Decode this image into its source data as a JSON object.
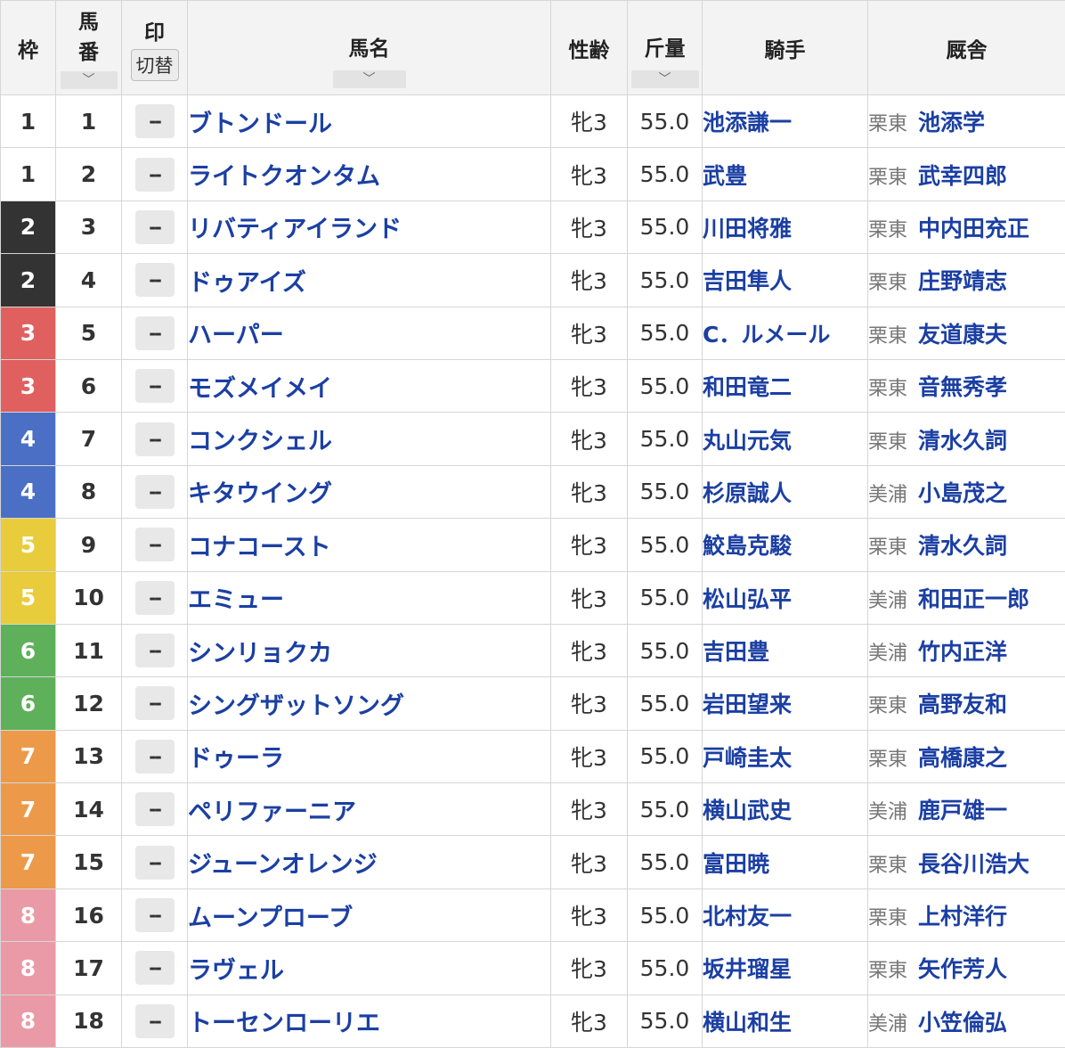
{
  "header": {
    "waku": "枠",
    "umaban_line1": "馬",
    "umaban_line2": "番",
    "mark": "印",
    "mark_toggle": "切替",
    "horse": "馬名",
    "sexage": "性齢",
    "weight": "斤量",
    "jockey": "騎手",
    "stable": "厩舎",
    "sort_glyph": "﹀"
  },
  "mark_placeholder": "--",
  "waku_colors": {
    "1": {
      "bg": "#ffffff",
      "fg": "#333333"
    },
    "2": {
      "bg": "#333333",
      "fg": "#ffffff"
    },
    "3": {
      "bg": "#e06060",
      "fg": "#ffffff"
    },
    "4": {
      "bg": "#4a6fc4",
      "fg": "#ffffff"
    },
    "5": {
      "bg": "#e8cc3c",
      "fg": "#ffffff"
    },
    "6": {
      "bg": "#5fb05a",
      "fg": "#ffffff"
    },
    "7": {
      "bg": "#ec9a4a",
      "fg": "#ffffff"
    },
    "8": {
      "bg": "#ea9aa6",
      "fg": "#ffffff"
    }
  },
  "rows": [
    {
      "waku": "1",
      "umaban": "1",
      "horse": "ブトンドール",
      "sexage": "牝3",
      "weight": "55.0",
      "jockey": "池添謙一",
      "region": "栗東",
      "trainer": "池添学"
    },
    {
      "waku": "1",
      "umaban": "2",
      "horse": "ライトクオンタム",
      "sexage": "牝3",
      "weight": "55.0",
      "jockey": "武豊",
      "region": "栗東",
      "trainer": "武幸四郎"
    },
    {
      "waku": "2",
      "umaban": "3",
      "horse": "リバティアイランド",
      "sexage": "牝3",
      "weight": "55.0",
      "jockey": "川田将雅",
      "region": "栗東",
      "trainer": "中内田充正"
    },
    {
      "waku": "2",
      "umaban": "4",
      "horse": "ドゥアイズ",
      "sexage": "牝3",
      "weight": "55.0",
      "jockey": "吉田隼人",
      "region": "栗東",
      "trainer": "庄野靖志"
    },
    {
      "waku": "3",
      "umaban": "5",
      "horse": "ハーパー",
      "sexage": "牝3",
      "weight": "55.0",
      "jockey": "C．ルメール",
      "region": "栗東",
      "trainer": "友道康夫"
    },
    {
      "waku": "3",
      "umaban": "6",
      "horse": "モズメイメイ",
      "sexage": "牝3",
      "weight": "55.0",
      "jockey": "和田竜二",
      "region": "栗東",
      "trainer": "音無秀孝"
    },
    {
      "waku": "4",
      "umaban": "7",
      "horse": "コンクシェル",
      "sexage": "牝3",
      "weight": "55.0",
      "jockey": "丸山元気",
      "region": "栗東",
      "trainer": "清水久詞"
    },
    {
      "waku": "4",
      "umaban": "8",
      "horse": "キタウイング",
      "sexage": "牝3",
      "weight": "55.0",
      "jockey": "杉原誠人",
      "region": "美浦",
      "trainer": "小島茂之"
    },
    {
      "waku": "5",
      "umaban": "9",
      "horse": "コナコースト",
      "sexage": "牝3",
      "weight": "55.0",
      "jockey": "鮫島克駿",
      "region": "栗東",
      "trainer": "清水久詞"
    },
    {
      "waku": "5",
      "umaban": "10",
      "horse": "エミュー",
      "sexage": "牝3",
      "weight": "55.0",
      "jockey": "松山弘平",
      "region": "美浦",
      "trainer": "和田正一郎"
    },
    {
      "waku": "6",
      "umaban": "11",
      "horse": "シンリョクカ",
      "sexage": "牝3",
      "weight": "55.0",
      "jockey": "吉田豊",
      "region": "美浦",
      "trainer": "竹内正洋"
    },
    {
      "waku": "6",
      "umaban": "12",
      "horse": "シングザットソング",
      "sexage": "牝3",
      "weight": "55.0",
      "jockey": "岩田望来",
      "region": "栗東",
      "trainer": "高野友和"
    },
    {
      "waku": "7",
      "umaban": "13",
      "horse": "ドゥーラ",
      "sexage": "牝3",
      "weight": "55.0",
      "jockey": "戸崎圭太",
      "region": "栗東",
      "trainer": "高橋康之"
    },
    {
      "waku": "7",
      "umaban": "14",
      "horse": "ペリファーニア",
      "sexage": "牝3",
      "weight": "55.0",
      "jockey": "横山武史",
      "region": "美浦",
      "trainer": "鹿戸雄一"
    },
    {
      "waku": "7",
      "umaban": "15",
      "horse": "ジューンオレンジ",
      "sexage": "牝3",
      "weight": "55.0",
      "jockey": "富田暁",
      "region": "栗東",
      "trainer": "長谷川浩大"
    },
    {
      "waku": "8",
      "umaban": "16",
      "horse": "ムーンプローブ",
      "sexage": "牝3",
      "weight": "55.0",
      "jockey": "北村友一",
      "region": "栗東",
      "trainer": "上村洋行"
    },
    {
      "waku": "8",
      "umaban": "17",
      "horse": "ラヴェル",
      "sexage": "牝3",
      "weight": "55.0",
      "jockey": "坂井瑠星",
      "region": "栗東",
      "trainer": "矢作芳人"
    },
    {
      "waku": "8",
      "umaban": "18",
      "horse": "トーセンローリエ",
      "sexage": "牝3",
      "weight": "55.0",
      "jockey": "横山和生",
      "region": "美浦",
      "trainer": "小笠倫弘"
    }
  ]
}
